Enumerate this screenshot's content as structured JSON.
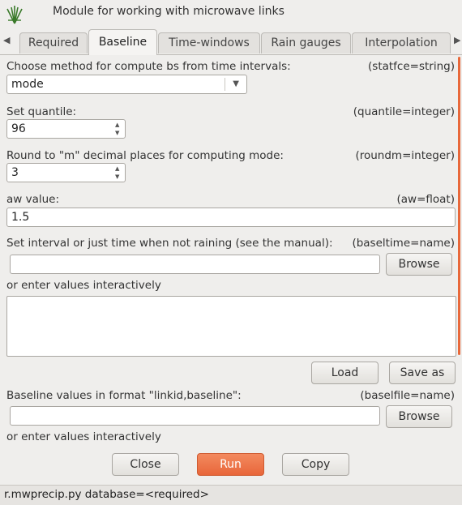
{
  "window": {
    "title": "Module for working with microwave links",
    "logo_icon": "grass-logo-icon"
  },
  "tabs": [
    {
      "label": "Required",
      "active": false
    },
    {
      "label": "Baseline",
      "active": true
    },
    {
      "label": "Time-windows",
      "active": false
    },
    {
      "label": "Rain gauges",
      "active": false
    },
    {
      "label": "Interpolation",
      "active": false
    }
  ],
  "fields": {
    "statfce": {
      "label": "Choose method for compute bs from time intervals:",
      "key": "(statfce=string)",
      "value": "mode"
    },
    "quantile": {
      "label": "Set quantile:",
      "key": "(quantile=integer)",
      "value": "96"
    },
    "roundm": {
      "label": "Round to \"m\" decimal places for computing mode:",
      "key": "(roundm=integer)",
      "value": "3"
    },
    "aw": {
      "label": "aw value:",
      "key": "(aw=float)",
      "value": "1.5"
    },
    "baseltime": {
      "label": "Set interval or just time when not raining (see the manual):",
      "key": "(baseltime=name)",
      "value": "",
      "browse_label": "Browse",
      "interactive_label": "or enter values interactively",
      "load_label": "Load",
      "saveas_label": "Save as"
    },
    "baselfile": {
      "label": "Baseline values in format \"linkid,baseline\":",
      "key": "(baselfile=name)",
      "value": "",
      "browse_label": "Browse",
      "interactive_label": "or enter values interactively"
    }
  },
  "buttons": {
    "close": "Close",
    "run": "Run",
    "copy": "Copy"
  },
  "status": {
    "command": "r.mwprecip.py database=<required>"
  },
  "colors": {
    "accent": "#e8663a",
    "background": "#efeeec"
  }
}
